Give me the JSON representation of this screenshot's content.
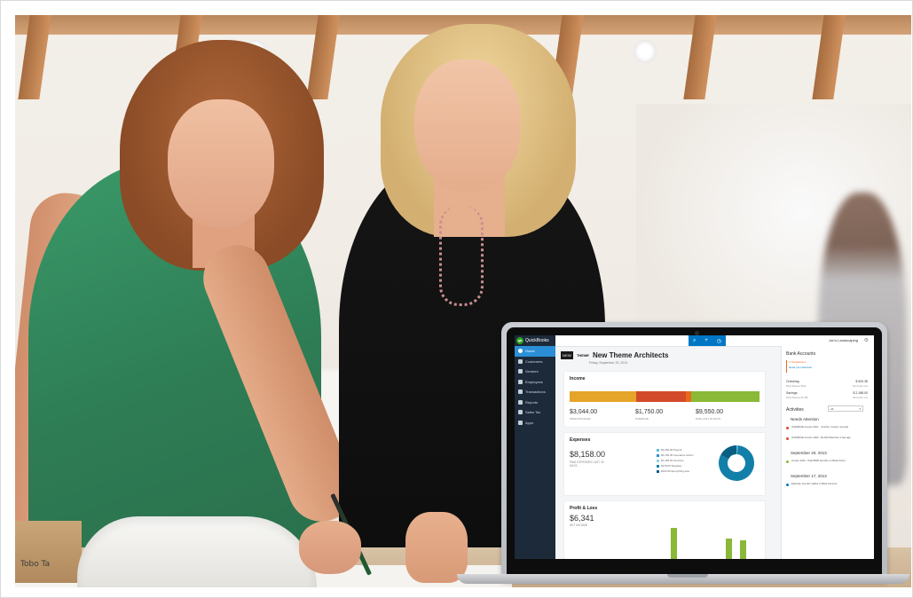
{
  "box_label": "Tobo Ta",
  "quickbooks": {
    "brand": "QuickBooks",
    "brand_logo": "qb",
    "company_name": "Jon's Landscaping",
    "sidebar": [
      {
        "label": "Home",
        "active": true
      },
      {
        "label": "Customers",
        "active": false
      },
      {
        "label": "Vendors",
        "active": false
      },
      {
        "label": "Employees",
        "active": false
      },
      {
        "label": "Transactions",
        "active": false
      },
      {
        "label": "Reports",
        "active": false
      },
      {
        "label": "Sales Tax",
        "active": false
      },
      {
        "label": "Apps",
        "active": false
      }
    ],
    "company": {
      "logo_text": "NEW",
      "theme_text": "THEME",
      "title": "New Theme Architects",
      "date": "Friday, September 20, 2013"
    },
    "income": {
      "title": "Income",
      "values": [
        {
          "amount": "$3,044.00",
          "label": "OPEN INVOICES"
        },
        {
          "amount": "$1,750.00",
          "label": "OVERDUE"
        },
        {
          "amount": "$9,550.00",
          "label": "PAID LAST 30 DAYS"
        }
      ]
    },
    "expenses": {
      "title": "Expenses",
      "amount": "$8,158.00",
      "label": "PAID EXPENSES LAST 30 DAYS",
      "legend": [
        {
          "label": "$4,284.00 Payroll",
          "color": "#58c3d8"
        },
        {
          "label": "$3,156.00 Insurance Admin",
          "color": "#2a8fd6"
        },
        {
          "label": "$1,465.00 Services",
          "color": "#8fd3e3"
        },
        {
          "label": "$478.00 Supplies",
          "color": "#127fa9"
        },
        {
          "label": "$102.00 Everything else",
          "color": "#0b5e83"
        }
      ]
    },
    "profit": {
      "title": "Profit & Loss",
      "amount": "$6,341",
      "label": "NET INCOME"
    },
    "bank": {
      "title": "Bank Accounts",
      "alert_count": "2 Transactions",
      "alert_action": "Need your attention",
      "accounts": [
        {
          "name": "Checking",
          "balance": "$ 520.35",
          "sub": "Bank Balance $520",
          "sub2": "Reconcile now"
        },
        {
          "name": "Savings",
          "balance": "$ 2,188.00",
          "sub": "Bank Balance $2,188",
          "sub2": "Reconcile now"
        }
      ]
    },
    "activities": {
      "title": "Activities",
      "filter": "All",
      "groups": [
        {
          "header": "Needs Attention",
          "items": [
            {
              "color": "#d34a2a",
              "text": "OVERDUE Invoice 1021 - Jennifer, Invoice not paid"
            },
            {
              "color": "#d34a2a",
              "text": "OVERDUE Invoice 1002 - $1,400 Was Due 2 day ago"
            }
          ]
        },
        {
          "header": "September 20, 2013",
          "items": [
            {
              "color": "#8ab837",
              "text": "Invoice 1021 - Paid $500 Jennifer on Bank Peers"
            }
          ]
        },
        {
          "header": "September 17, 2013",
          "items": [
            {
              "color": "#0077c5",
              "text": "Estimate Jennifer added to Bank Account"
            }
          ]
        }
      ]
    }
  }
}
